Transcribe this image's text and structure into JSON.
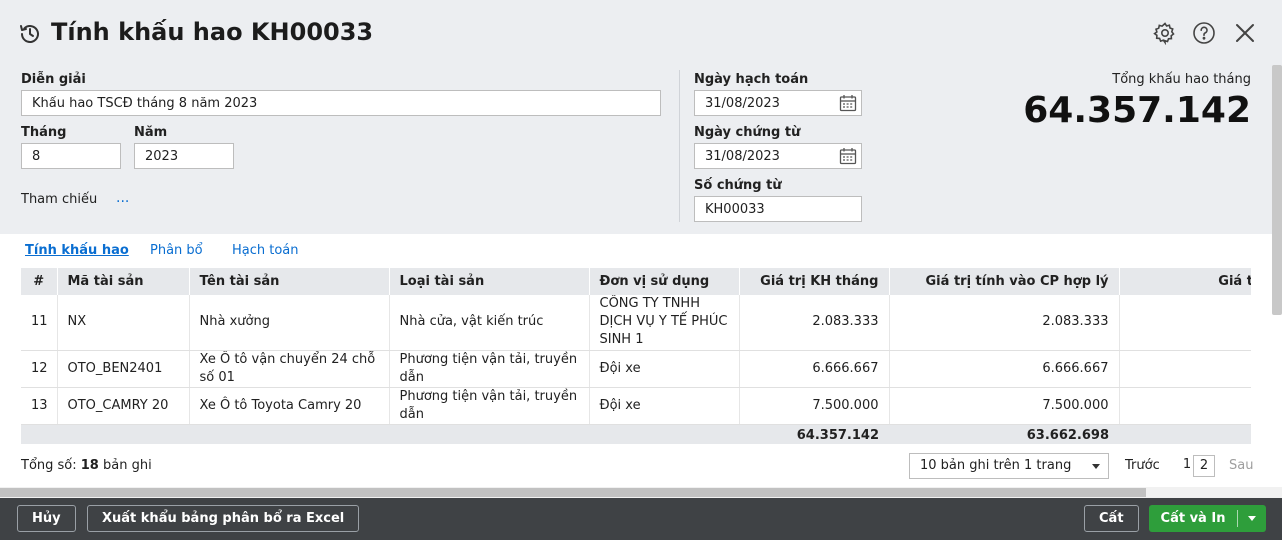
{
  "dialog": {
    "title": "Tính khấu hao KH00033",
    "icons": {
      "title": "history-icon",
      "settings": "gear-icon",
      "help": "help-icon",
      "close": "close-icon"
    }
  },
  "form": {
    "description_label": "Diễn giải",
    "description_value": "Khấu hao TSCĐ tháng 8 năm 2023",
    "month_label": "Tháng",
    "month_value": "8",
    "year_label": "Năm",
    "year_value": "2023",
    "reference_label": "Tham chiếu",
    "reference_more": "...",
    "posting_date_label": "Ngày hạch toán",
    "posting_date_value": "31/08/2023",
    "voucher_date_label": "Ngày chứng từ",
    "voucher_date_value": "31/08/2023",
    "voucher_no_label": "Số chứng từ",
    "voucher_no_value": "KH00033"
  },
  "summary": {
    "total_label": "Tổng khấu hao tháng",
    "total_value": "64.357.142"
  },
  "tabs": [
    {
      "label": "Tính khấu hao",
      "active": true
    },
    {
      "label": "Phân bổ",
      "active": false
    },
    {
      "label": "Hạch toán",
      "active": false
    }
  ],
  "grid": {
    "columns": [
      "#",
      "Mã tài sản",
      "Tên tài sản",
      "Loại tài sản",
      "Đơn vị sử dụng",
      "Giá trị KH tháng",
      "Giá trị tính vào CP hợp lý",
      "Giá trị tính v"
    ],
    "rows": [
      {
        "no": "11",
        "code": "NX",
        "name": "Nhà xưởng",
        "type": "Nhà cửa, vật kiến trúc",
        "unit": "CÔNG TY TNHH DỊCH VỤ Y TẾ PHÚC SINH 1",
        "monthly": "2.083.333",
        "reasonable": "2.083.333"
      },
      {
        "no": "12",
        "code": "OTO_BEN2401",
        "name": "Xe Ô tô vận chuyển 24 chỗ số 01",
        "type": "Phương tiện vận tải, truyền dẫn",
        "unit": "Đội xe",
        "monthly": "6.666.667",
        "reasonable": "6.666.667"
      },
      {
        "no": "13",
        "code": "OTO_CAMRY 20",
        "name": "Xe Ô tô Toyota Camry 20",
        "type": "Phương tiện vận tải, truyền dẫn",
        "unit": "Đội xe",
        "monthly": "7.500.000",
        "reasonable": "7.500.000"
      }
    ],
    "totals": {
      "monthly": "64.357.142",
      "reasonable": "63.662.698"
    }
  },
  "pager": {
    "total_prefix": "Tổng số:",
    "total_count": "18",
    "total_suffix": "bản ghi",
    "page_size": "10 bản ghi trên 1 trang",
    "prev": "Trước",
    "pages": [
      "1",
      "2"
    ],
    "current_page": "2",
    "next": "Sau"
  },
  "footer": {
    "cancel": "Hủy",
    "export": "Xuất khẩu bảng phân bổ ra Excel",
    "save": "Cất",
    "save_print": "Cất và In"
  }
}
